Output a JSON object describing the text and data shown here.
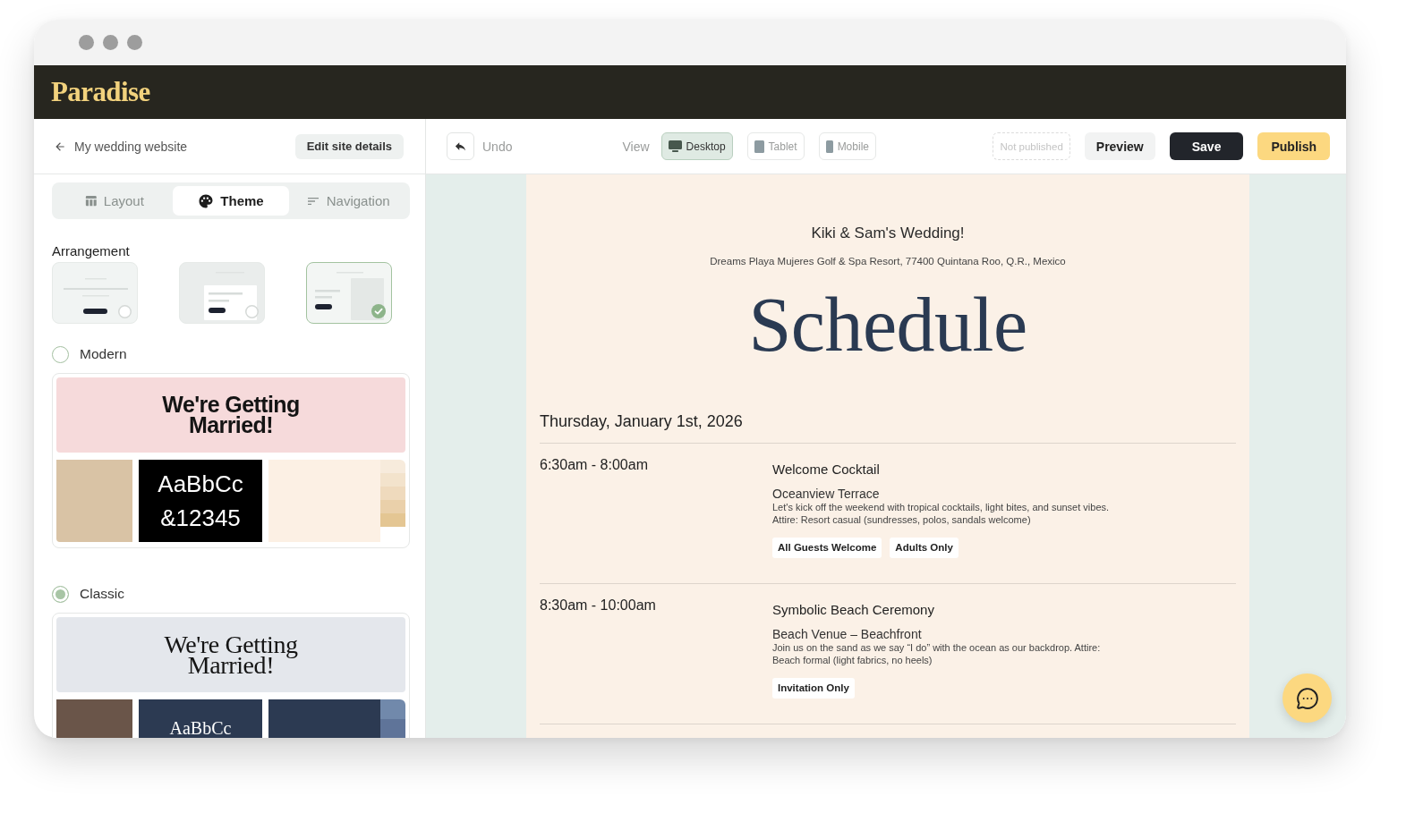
{
  "header": {
    "logo": "Paradise"
  },
  "sidebar": {
    "back_link": "My wedding website",
    "edit_button": "Edit site details",
    "tabs": [
      {
        "label": "Layout",
        "kind": "layout",
        "selected": false
      },
      {
        "label": "Theme",
        "kind": "theme",
        "selected": true
      },
      {
        "label": "Navigation",
        "kind": "navigation",
        "selected": false
      }
    ],
    "arrangement": {
      "label": "Arrangement",
      "options": [
        {
          "kind": "centered",
          "selected": false
        },
        {
          "kind": "card",
          "selected": false
        },
        {
          "kind": "split",
          "selected": true
        }
      ]
    },
    "themes": [
      {
        "name": "Modern",
        "kind": "sans",
        "selected": false,
        "banner": "We're Getting Married!",
        "font_sample": [
          "AaBbCc",
          "&12345"
        ],
        "palette": [
          {
            "color": "#fcf0e4"
          },
          {
            "color": "#f7ebdc"
          },
          {
            "color": "#f3e3cc"
          },
          {
            "color": "#efdabd"
          },
          {
            "color": "#ead0aa"
          },
          {
            "color": "#e4c693"
          }
        ]
      },
      {
        "name": "Classic",
        "kind": "serif",
        "selected": true,
        "banner": "We're Getting Married!",
        "font_sample": [
          "AaBbCc"
        ],
        "palette": [
          {
            "color": "#2c3a52"
          },
          {
            "color": "#7189ab"
          },
          {
            "color": "#5f7499"
          }
        ]
      }
    ]
  },
  "toolbar": {
    "undo": "Undo",
    "view_label": "View",
    "views": [
      {
        "label": "Desktop",
        "kind": "desktop",
        "selected": true
      },
      {
        "label": "Tablet",
        "kind": "tablet",
        "selected": false
      },
      {
        "label": "Mobile",
        "kind": "mobile",
        "selected": false
      }
    ],
    "status": "Not published",
    "preview": "Preview",
    "save": "Save",
    "publish": "Publish"
  },
  "page": {
    "title": "Kiki & Sam's Wedding!",
    "address": "Dreams Playa Mujeres Golf & Spa Resort, 77400 Quintana Roo, Q.R., Mexico",
    "heading": "Schedule",
    "date": "Thursday, January 1st, 2026",
    "events": [
      {
        "time": "6:30am - 8:00am",
        "title": "Welcome Cocktail",
        "venue": "Oceanview Terrace",
        "description": "Let's kick off the weekend with tropical cocktails, light bites, and sunset vibes.\nAttire: Resort casual (sundresses, polos, sandals welcome)",
        "tags": [
          "All Guests Welcome",
          "Adults Only"
        ]
      },
      {
        "time": "8:30am - 10:00am",
        "title": "Symbolic Beach Ceremony",
        "venue": "Beach Venue – Beachfront",
        "description": "Join us on the sand as we say “I do” with the ocean as our backdrop. Attire:\nBeach formal (light fabrics, no heels)",
        "tags": [
          "Invitation Only"
        ]
      }
    ]
  }
}
